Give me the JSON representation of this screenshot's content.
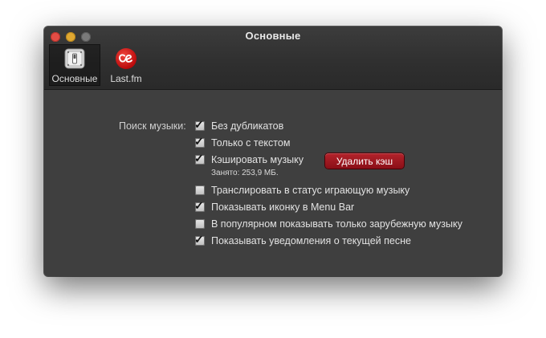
{
  "window": {
    "title": "Основные"
  },
  "toolbar": {
    "items": [
      {
        "label": "Основные",
        "icon": "switch-icon",
        "selected": true
      },
      {
        "label": "Last.fm",
        "icon": "lastfm-icon",
        "selected": false
      }
    ]
  },
  "settings": {
    "music_search_label": "Поиск музыки:",
    "options": [
      {
        "label": "Без дубликатов",
        "checked": true
      },
      {
        "label": "Только с текстом",
        "checked": true
      },
      {
        "label": "Кэшировать музыку",
        "checked": true
      },
      {
        "label": "Транслировать в статус играющую музыку",
        "checked": false
      },
      {
        "label": "Показывать иконку в Menu Bar",
        "checked": true
      },
      {
        "label": "В популярном показывать только зарубежную музыку",
        "checked": false
      },
      {
        "label": "Показывать уведомления о текущей песне",
        "checked": true
      }
    ],
    "cache_info": "Занято: 253,9 МБ.",
    "clear_cache_label": "Удалить кэш"
  },
  "colors": {
    "accent_button": "#9a1a22",
    "lastfm_red": "#d51007"
  }
}
